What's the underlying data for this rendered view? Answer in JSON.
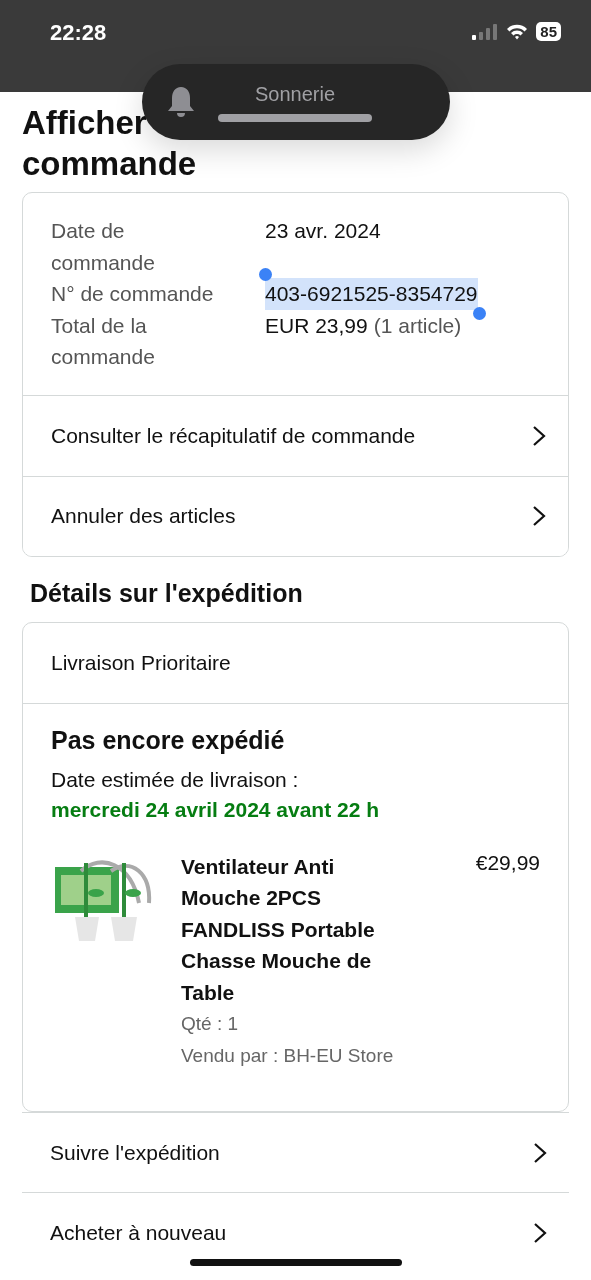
{
  "status_bar": {
    "time": "22:28",
    "battery": "85"
  },
  "ringer": {
    "label": "Sonnerie"
  },
  "title": [
    "Afficher",
    "commande"
  ],
  "order_summary": {
    "rows": [
      {
        "label": "Date de commande",
        "value": "23 avr. 2024",
        "selected": false
      },
      {
        "label": "N° de commande",
        "value": "403-6921525-8354729",
        "selected": true
      },
      {
        "label": "Total de la commande",
        "value": "EUR 23,99",
        "note": "(1 article)",
        "selected": false
      }
    ],
    "links": [
      "Consulter le récapitulatif de commande",
      "Annuler des articles"
    ]
  },
  "shipping": {
    "heading": "Détails sur l'expédition",
    "method": "Livraison Prioritaire",
    "status": "Pas encore expédié",
    "estimate_label": "Date estimée de livraison :",
    "estimate_date": "mercredi 24 avril 2024 avant 22 h",
    "item": {
      "kind": "picture",
      "title": "Ventilateur Anti Mouche 2PCS FANDLISS Portable Chasse Mouche de Table",
      "price": "€29,99",
      "quantity": "Qté : 1",
      "seller": "Vendu par : BH-EU Store"
    }
  },
  "actions": [
    "Suivre l'expédition",
    "Acheter à nouveau"
  ]
}
